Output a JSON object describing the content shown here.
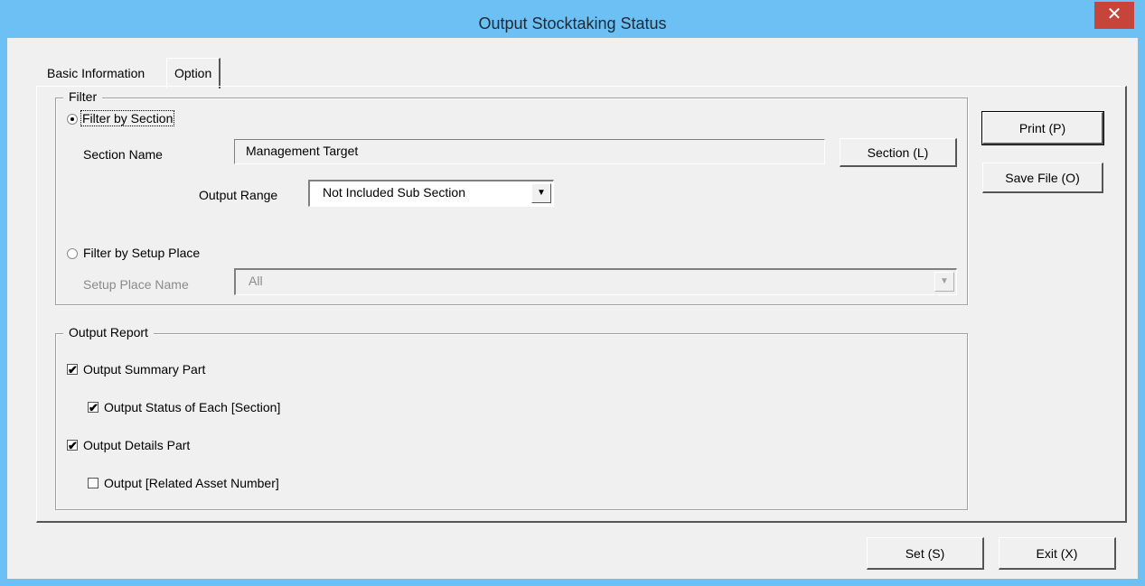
{
  "window": {
    "title": "Output Stocktaking Status",
    "close_glyph": "✕"
  },
  "tabs": [
    {
      "label": "Basic Information",
      "active": false
    },
    {
      "label": "Option",
      "active": true
    }
  ],
  "filter": {
    "legend": "Filter",
    "by_section": {
      "label": "Filter by Section",
      "selected": true,
      "section_name_label": "Section Name",
      "section_name_value": "Management Target",
      "section_button": "Section (L)",
      "output_range_label": "Output Range",
      "output_range_value": "Not Included Sub Section"
    },
    "by_setup_place": {
      "label": "Filter by Setup Place",
      "selected": false,
      "setup_place_label": "Setup Place Name",
      "setup_place_value": "All"
    }
  },
  "output_report": {
    "legend": "Output Report",
    "items": [
      {
        "label": "Output Summary Part",
        "checked": true
      },
      {
        "label": "Output Status of Each [Section]",
        "checked": true
      },
      {
        "label": "Output Details Part",
        "checked": true
      },
      {
        "label": "Output [Related Asset Number]",
        "checked": false
      }
    ]
  },
  "side_buttons": {
    "print": "Print (P)",
    "save_file": "Save File (O)"
  },
  "footer_buttons": {
    "set": "Set (S)",
    "exit": "Exit (X)"
  },
  "icons": {
    "check": "✔",
    "dropdown": "▼"
  }
}
